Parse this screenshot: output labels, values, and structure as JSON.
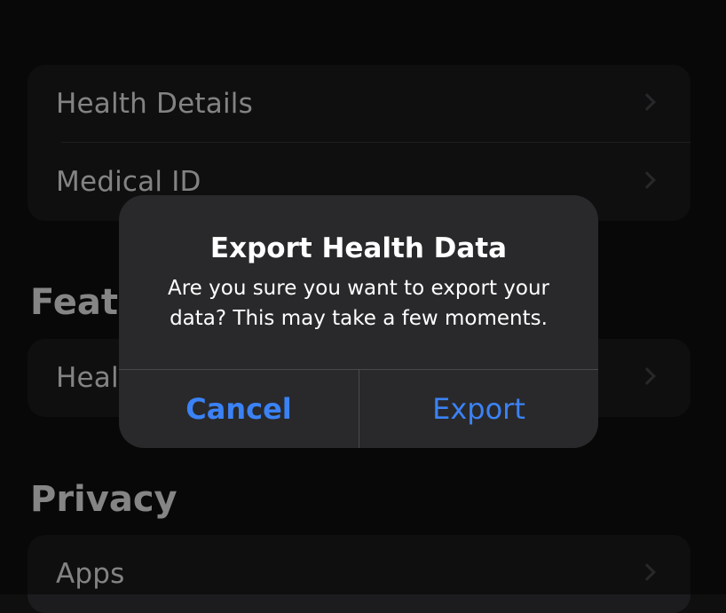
{
  "health_group": {
    "rows": [
      {
        "label": "Health Details"
      },
      {
        "label": "Medical ID"
      }
    ]
  },
  "features": {
    "header": "Features",
    "rows": [
      {
        "label": "Health Checklist"
      }
    ]
  },
  "privacy": {
    "header": "Privacy",
    "rows": [
      {
        "label": "Apps"
      }
    ]
  },
  "alert": {
    "title": "Export Health Data",
    "message": "Are you sure you want to export your data? This may take a few moments.",
    "cancel_label": "Cancel",
    "confirm_label": "Export"
  },
  "colors": {
    "accent": "#3b82f6",
    "background": "#0f0f10",
    "group_background": "#1c1c1e",
    "alert_background": "#29292b"
  }
}
